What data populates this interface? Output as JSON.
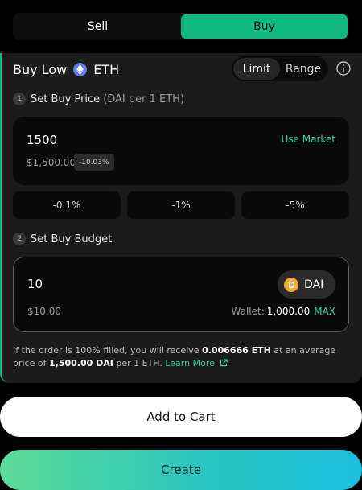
{
  "tabs": {
    "sell": "Sell",
    "buy": "Buy"
  },
  "header": {
    "title": "Buy Low",
    "token": "ETH",
    "mode_limit": "Limit",
    "mode_range": "Range"
  },
  "step1": {
    "num": "1",
    "label": "Set Buy Price",
    "sub": "(DAI per 1 ETH)"
  },
  "price": {
    "value": "1500",
    "use_market": "Use Market",
    "usd": "$1,500.00",
    "pct": "-10.03%"
  },
  "adjust": [
    "-0.1%",
    "-1%",
    "-5%"
  ],
  "step2": {
    "num": "2",
    "label": "Set Buy Budget"
  },
  "budget": {
    "value": "10",
    "token": "DAI",
    "usd": "$10.00",
    "wallet_label": "Wallet:",
    "wallet_balance": "1,000.00",
    "max": "MAX"
  },
  "summary": {
    "p1": "If the order is 100% filled, you will receive ",
    "amount": "0.006666 ETH",
    "p2": " at an average price of ",
    "price": "1,500.00 DAI",
    "p3": " per 1 ETH. ",
    "learn": "Learn More"
  },
  "actions": {
    "cart": "Add to Cart",
    "create": "Create"
  },
  "colors": {
    "accent": "#10b981",
    "eth": "#627eea",
    "dai": "#f5ac37"
  }
}
